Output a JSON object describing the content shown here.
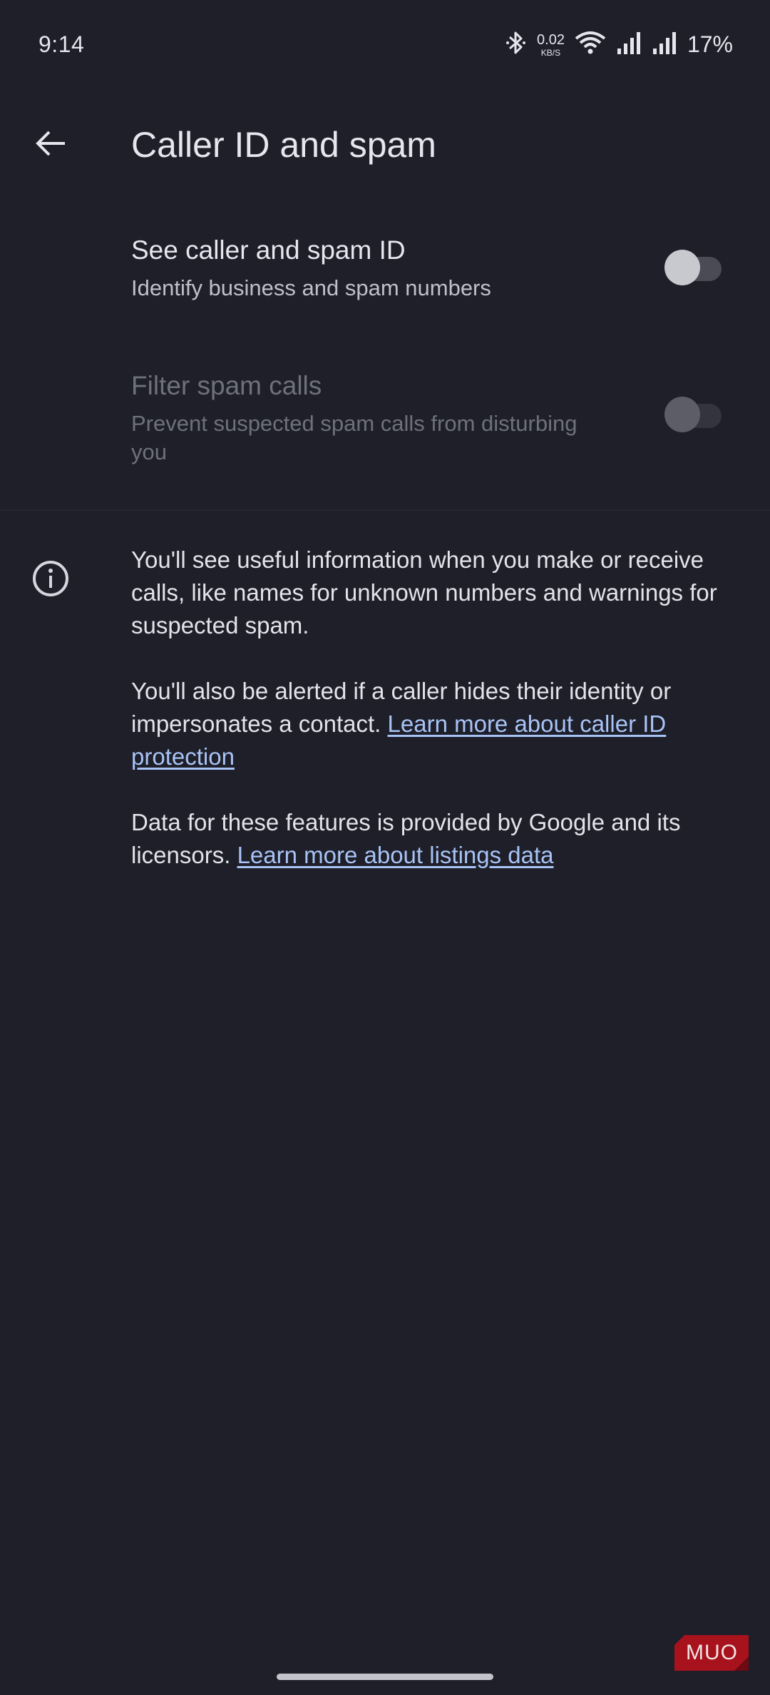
{
  "status_bar": {
    "time": "9:14",
    "net_speed_value": "0.02",
    "net_speed_unit": "KB/S",
    "battery": "17%",
    "icons": [
      "bluetooth-icon",
      "wifi-icon",
      "signal-icon",
      "signal-icon",
      "battery-percent"
    ]
  },
  "app_bar": {
    "title": "Caller ID and spam",
    "back_icon": "arrow-back-icon"
  },
  "settings": [
    {
      "title": "See caller and spam ID",
      "subtitle": "Identify business and spam numbers",
      "enabled": true,
      "toggle_on": false
    },
    {
      "title": "Filter spam calls",
      "subtitle": "Prevent suspected spam calls from disturbing you",
      "enabled": false,
      "toggle_on": false
    }
  ],
  "info": {
    "icon": "info-icon",
    "paragraph1": "You'll see useful information when you make or receive calls, like names for unknown numbers and warnings for suspected spam.",
    "paragraph2_text": "You'll also be alerted if a caller hides their identity or impersonates a contact.",
    "paragraph2_link": "Learn more about caller ID protection",
    "paragraph3_text": "Data for these features is provided by Google and its licensors.",
    "paragraph3_link": "Learn more about listings data"
  },
  "watermark": {
    "label": "MUO"
  },
  "colors": {
    "background": "#1e1f29",
    "link": "#a8c3f5",
    "watermark": "#a8121d"
  }
}
